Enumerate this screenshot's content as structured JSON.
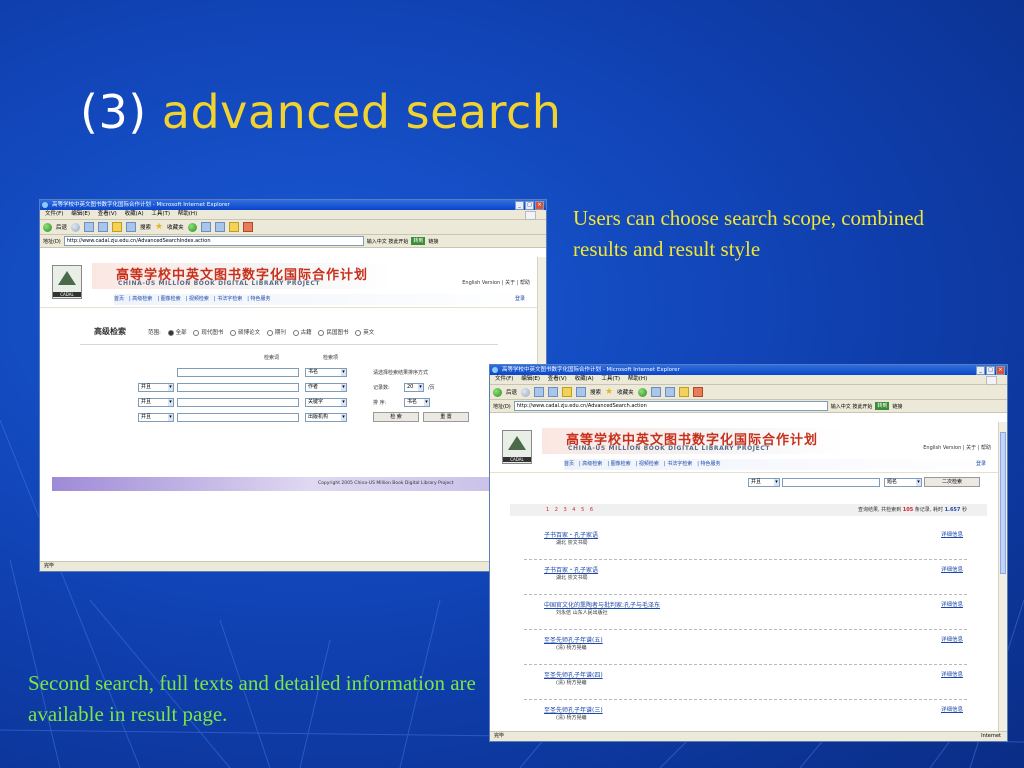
{
  "slide": {
    "title_prefix": "(3)",
    "title_main": "advanced search",
    "caption_right": "Users can choose search scope, combined results and result style",
    "caption_left": "Second search, full texts and detailed information are available in result page.",
    "colors": {
      "background": "#0f3fae",
      "title": "#ffffff",
      "title_accent": "#f2d22e",
      "caption_right": "#f2e633",
      "caption_left": "#7ce644"
    }
  },
  "browser": {
    "window_title": "高等学校中英文图书数字化国际合作计划 - Microsoft Internet Explorer",
    "menu": [
      "文件(F)",
      "编辑(E)",
      "查看(V)",
      "收藏(A)",
      "工具(T)",
      "帮助(H)"
    ],
    "toolbar": {
      "back": "后退",
      "search": "搜索",
      "favorites": "收藏夹"
    },
    "address_label": "地址(D)",
    "go_label": "转到",
    "links_label": "链接",
    "ime_label": "输入中文  按此开始",
    "status_done": "完毕",
    "status_zone": "Internet"
  },
  "site": {
    "banner_cn": "高等学校中英文图书数字化国际合作计划",
    "banner_en": "CHINA-US MILLION BOOK DIGITAL LIBRARY PROJECT",
    "logo_label": "CADAL",
    "lang_links": "English Version | 关于 | 帮助",
    "nav": [
      "首页",
      "高级检索",
      "图像检索",
      "视频检索",
      "书法字检索",
      "特色服务"
    ],
    "login": "登录"
  },
  "window1": {
    "url": "http://www.cadal.zju.edu.cn/AdvancedSearchIndex.action",
    "form": {
      "title": "高级检索",
      "scope_label": "范围:",
      "scope_options": [
        "全部",
        "现代图书",
        "硕博论文",
        "期刊",
        "古籍",
        "民国图书",
        "英文"
      ],
      "col_keyword": "检索词",
      "col_field": "检索项",
      "logic_op": "并且",
      "fields": [
        "书名",
        "作者",
        "关键字",
        "出版机构"
      ],
      "sort_label": "请选择检索结果排序方式",
      "records_label": "记录数:",
      "records_value": "20",
      "per_page": "/页",
      "order_label": "排    序:",
      "order_value": "书名",
      "search_button": "检  索",
      "reset_button": "重  置"
    },
    "copyright": "Copyright 2005 China-US Million Book Digital Library Project"
  },
  "window2": {
    "url": "http://www.cadal.zju.edu.cn/AdvancedSearch.action",
    "second_search": {
      "logic": "并且",
      "field": "题名",
      "button": "二次检索"
    },
    "pages": "1 2 3 4 5 6",
    "result_stats": {
      "prefix": "查询结果, 共检索到",
      "count": "105",
      "middle": "条记录, 耗时",
      "time": "1.657",
      "suffix": "秒"
    },
    "detail_label": "详细信息",
    "results": [
      {
        "title": "子书百家・孔子家语",
        "author": "湖北  崇文书局"
      },
      {
        "title": "子书百家・孔子家语",
        "author": "湖北  崇文书局"
      },
      {
        "title": "中国官文化的熏陶者与批判家:孔子与毛泽东",
        "author": "刘永佶  山东人民出版社"
      },
      {
        "title": "至圣先师孔子年谱(五)",
        "author": "(清)  杨方晃编"
      },
      {
        "title": "至圣先师孔子年谱(四)",
        "author": "(清)  杨方晃编"
      },
      {
        "title": "至圣先师孔子年谱(三)",
        "author": "(清)  杨方晃编"
      }
    ]
  }
}
